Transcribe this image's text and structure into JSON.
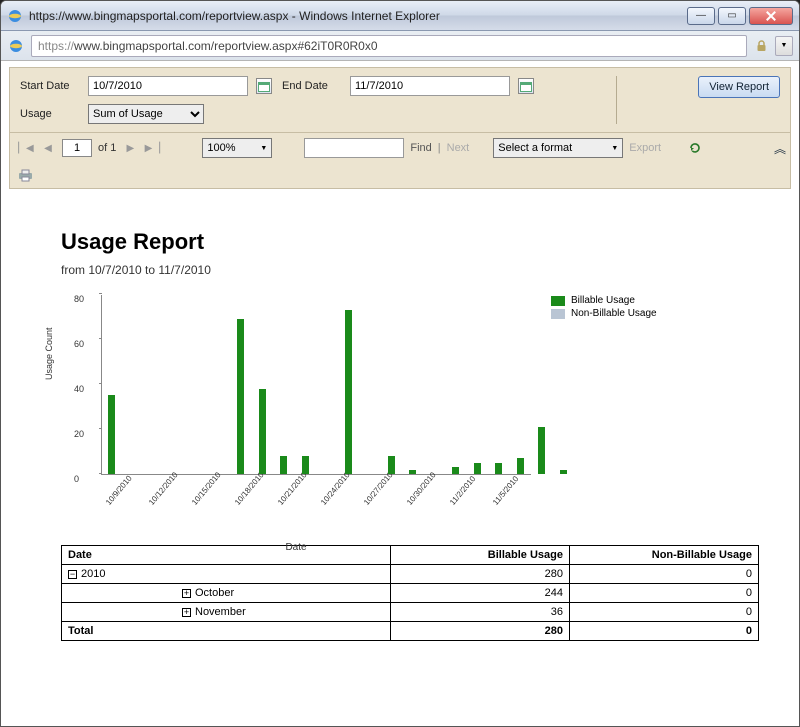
{
  "window": {
    "title": "https://www.bingmapsportal.com/reportview.aspx - Windows Internet Explorer",
    "url_prefix": "https://",
    "url_rest": "www.bingmapsportal.com/reportview.aspx#62iT0R0R0x0"
  },
  "filters": {
    "start_label": "Start Date",
    "start_value": "10/7/2010",
    "end_label": "End Date",
    "end_value": "11/7/2010",
    "usage_label": "Usage",
    "usage_value": "Sum of Usage",
    "view_btn": "View Report"
  },
  "toolbar": {
    "page_value": "1",
    "of_text": "of 1",
    "zoom": "100%",
    "find": "Find",
    "next": "Next",
    "format": "Select a format",
    "export": "Export"
  },
  "report": {
    "title": "Usage Report",
    "subtitle": "from 10/7/2010 to 11/7/2010"
  },
  "chart_data": {
    "type": "bar",
    "title": "",
    "xlabel": "Date",
    "ylabel": "Usage Count",
    "ylim": [
      0,
      80
    ],
    "yticks": [
      0,
      20,
      40,
      60,
      80
    ],
    "categories": [
      "10/9/2010",
      "10/12/2010",
      "10/15/2010",
      "10/18/2010",
      "10/21/2010",
      "10/24/2010",
      "10/27/2010",
      "10/30/2010",
      "11/2/2010",
      "11/5/2010"
    ],
    "series": [
      {
        "name": "Billable Usage",
        "color": "#1a8a1a",
        "points": [
          {
            "x": 0,
            "v": 35
          },
          {
            "x": 6,
            "v": 69
          },
          {
            "x": 7,
            "v": 38
          },
          {
            "x": 8,
            "v": 8
          },
          {
            "x": 9,
            "v": 8
          },
          {
            "x": 11,
            "v": 73
          },
          {
            "x": 13,
            "v": 8
          },
          {
            "x": 14,
            "v": 2
          },
          {
            "x": 16,
            "v": 3
          },
          {
            "x": 17,
            "v": 5
          },
          {
            "x": 18,
            "v": 5
          },
          {
            "x": 19,
            "v": 7
          },
          {
            "x": 20,
            "v": 21
          },
          {
            "x": 21,
            "v": 2
          }
        ]
      },
      {
        "name": "Non-Billable Usage",
        "color": "#b9c5d4",
        "points": []
      }
    ],
    "legend": [
      "Billable Usage",
      "Non-Billable Usage"
    ]
  },
  "table": {
    "headers": [
      "Date",
      "Billable Usage",
      "Non-Billable Usage"
    ],
    "rows": [
      {
        "label": "2010",
        "exp": "-",
        "indent": 0,
        "billable": 280,
        "nonbillable": 0,
        "bold": false
      },
      {
        "label": "October",
        "exp": "+",
        "indent": 1,
        "billable": 244,
        "nonbillable": 0,
        "bold": false
      },
      {
        "label": "November",
        "exp": "+",
        "indent": 1,
        "billable": 36,
        "nonbillable": 0,
        "bold": false
      }
    ],
    "total_label": "Total",
    "total_billable": 280,
    "total_nonbillable": 0
  }
}
